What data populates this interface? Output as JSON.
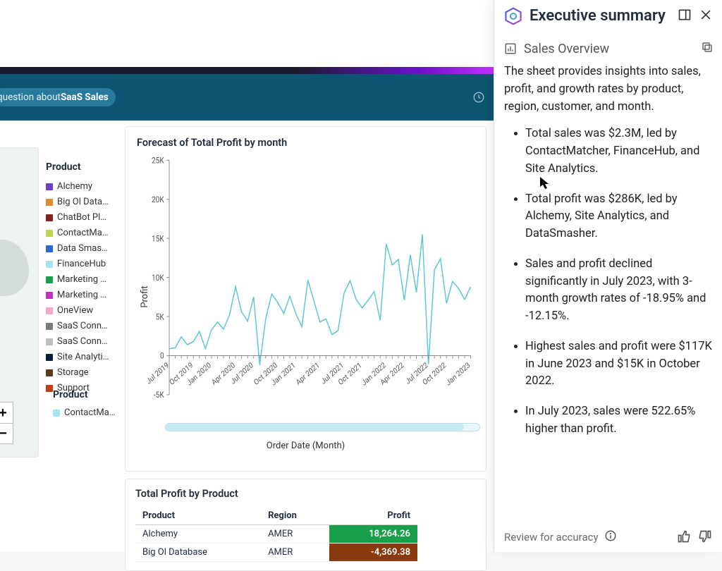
{
  "ask_bar": {
    "prefix": "question about ",
    "topic": "SaaS Sales"
  },
  "map": {
    "zoom_in": "+",
    "zoom_out": "−"
  },
  "product_legend": {
    "title": "Product",
    "items": [
      {
        "label": "Alchemy",
        "color": "#6a3fc9"
      },
      {
        "label": "Big Ol Data…",
        "color": "#e38b2c"
      },
      {
        "label": "ChatBot Pl…",
        "color": "#8a1f1f"
      },
      {
        "label": "ContactMa…",
        "color": "#b9d94a"
      },
      {
        "label": "Data Smas…",
        "color": "#2a6ad0"
      },
      {
        "label": "FinanceHub",
        "color": "#a7e3ef"
      },
      {
        "label": "Marketing …",
        "color": "#1aa04a"
      },
      {
        "label": "Marketing …",
        "color": "#c62cc6"
      },
      {
        "label": "OneView",
        "color": "#f4a7c8"
      },
      {
        "label": "SaaS Conn…",
        "color": "#7a7a7a"
      },
      {
        "label": "SaaS Conn…",
        "color": "#bdbdbd"
      },
      {
        "label": "Site Analytics",
        "color": "#0a1f3d"
      },
      {
        "label": "Storage",
        "color": "#5a3a1a"
      },
      {
        "label": "Support",
        "color": "#c63a1a"
      }
    ]
  },
  "chart_data": {
    "type": "line",
    "title": "Forecast of Total Profit by month",
    "ylabel": "Profit",
    "xlabel": "Order Date (Month)",
    "x": [
      "Jul 2019",
      "Oct 2019",
      "Jan 2020",
      "Apr 2020",
      "Jul 2020",
      "Oct 2020",
      "Jan 2021",
      "Apr 2021",
      "Jul 2021",
      "Oct 2021",
      "Jan 2022",
      "Apr 2022",
      "Jul 2022",
      "Oct 2022",
      "Jan 2023"
    ],
    "y_ticks": [
      -5000,
      0,
      5000,
      10000,
      15000,
      20000,
      25000
    ],
    "y_tick_labels": [
      "-5K",
      "0",
      "5K",
      "10K",
      "15K",
      "20K",
      "25K"
    ],
    "series": [
      {
        "name": "Total Profit",
        "color": "#5fc7d2",
        "values": [
          900,
          1000,
          2400,
          1400,
          1800,
          3100,
          900,
          3300,
          4300,
          3400,
          5200,
          8800,
          5600,
          4400,
          7500,
          -1200,
          4700,
          7900,
          6800,
          5400,
          7600,
          5400,
          3700,
          9700,
          7000,
          4300,
          4700,
          2700,
          3200,
          8000,
          9600,
          7200,
          6100,
          7100,
          8200,
          4500,
          14300,
          11600,
          12300,
          7100,
          12900,
          8100,
          15500,
          -1100,
          11000,
          12400,
          6700,
          9500,
          8600,
          7200,
          8800
        ]
      }
    ]
  },
  "profit_table": {
    "title": "Total Profit by Product",
    "columns": [
      "Product",
      "Region",
      "Profit"
    ],
    "rows": [
      {
        "product": "Alchemy",
        "region": "AMER",
        "profit": "18,264.26",
        "cell_bg": "#1aa04a"
      },
      {
        "product": "Big Ol Database",
        "region": "AMER",
        "profit": "-4,369.38",
        "cell_bg": "#8a3a0f"
      }
    ]
  },
  "legend2": {
    "title": "Product",
    "items": [
      {
        "label": "ContactMa…",
        "color": "#a7e3ef"
      }
    ]
  },
  "panel": {
    "title": "Executive summary",
    "sheet_label": "Sales Overview",
    "intro": "The sheet provides insights into sales, profit, and growth rates by product, region, customer, and month.",
    "bullets": [
      "Total sales was $2.3M, led by ContactMatcher, FinanceHub, and Site Analytics.",
      "Total profit was $286K, led by Alchemy, Site Analytics, and DataSmasher.",
      "Sales and profit declined significantly in July 2023, with 3-month growth rates of -18.95% and -12.15%.",
      "Highest sales and profit were $117K in June 2023 and $15K in October 2022.",
      "In July 2023, sales were 522.65% higher than profit."
    ],
    "review_label": "Review for accuracy"
  }
}
